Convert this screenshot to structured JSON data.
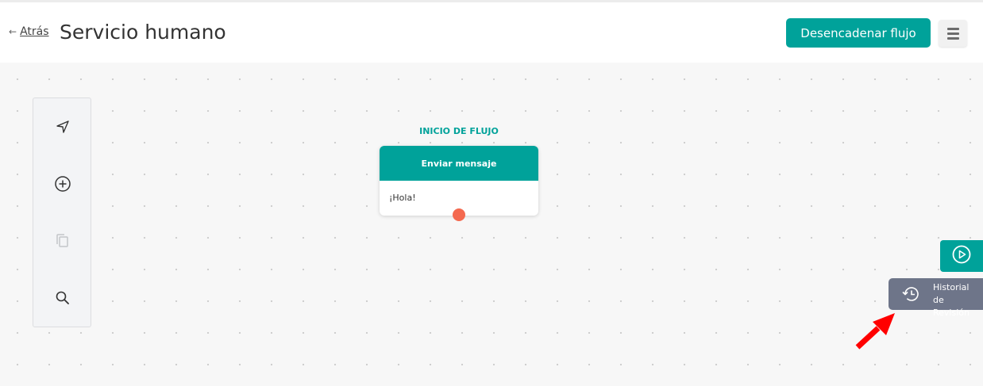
{
  "header": {
    "back_arrow": "←",
    "back_label": "Atrás",
    "title": "Servicio humano",
    "trigger_button": "Desencadenar flujo",
    "menu_icon": "hamburger-menu-icon"
  },
  "toolbar": {
    "items": [
      {
        "icon": "navigate-arrow-icon"
      },
      {
        "icon": "add-circle-icon"
      },
      {
        "icon": "copy-icon"
      },
      {
        "icon": "search-icon"
      }
    ]
  },
  "flow": {
    "start_label": "INICIO DE FLUJO",
    "node": {
      "header": "Enviar mensaje",
      "message": "¡Hola!"
    }
  },
  "side_buttons": {
    "play_icon": "play-circle-icon",
    "history_icon": "history-icon",
    "history_line1": "Historial",
    "history_line2": "de Revisión"
  },
  "colors": {
    "accent": "#00a29a",
    "node_dot": "#f4694f",
    "history_bg": "#6e7589",
    "annotation_arrow": "#ff0000"
  }
}
